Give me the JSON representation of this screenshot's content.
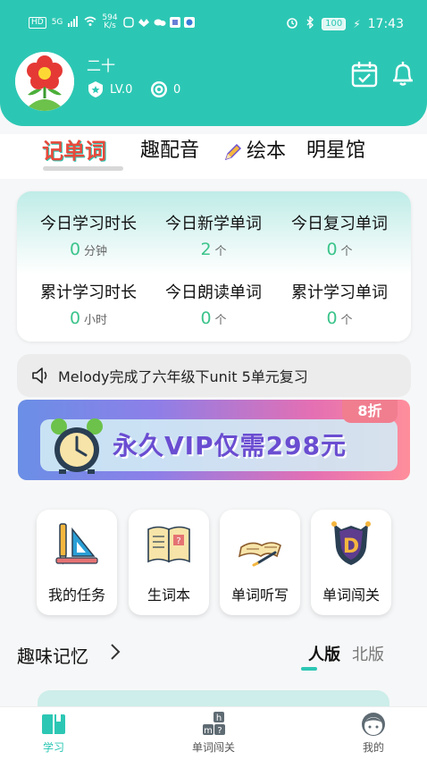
{
  "status_bar": {
    "left": {
      "hd": "HD",
      "signal": "5G",
      "speed_value": "594",
      "speed_unit": "K/s"
    },
    "right": {
      "battery": "100",
      "time": "17:43"
    }
  },
  "profile": {
    "username": "二十",
    "level": "LV.0",
    "coins": "0"
  },
  "tabs": [
    {
      "label": "记单词",
      "active": true
    },
    {
      "label": "趣配音",
      "active": false
    },
    {
      "label": "绘本",
      "active": false,
      "icon": "pencil-icon"
    },
    {
      "label": "明星馆",
      "active": false
    }
  ],
  "stats": [
    {
      "label": "今日学习时长",
      "value": "0",
      "unit": "分钟"
    },
    {
      "label": "今日新学单词",
      "value": "2",
      "unit": "个"
    },
    {
      "label": "今日复习单词",
      "value": "0",
      "unit": "个"
    },
    {
      "label": "累计学习时长",
      "value": "0",
      "unit": "小时"
    },
    {
      "label": "今日朗读单词",
      "value": "0",
      "unit": "个"
    },
    {
      "label": "累计学习单词",
      "value": "0",
      "unit": "个"
    }
  ],
  "notice": {
    "text": "Melody完成了六年级下unit 5单元复习",
    "icon": "speaker-icon"
  },
  "banner": {
    "text": "永久VIP仅需298元",
    "badge": "8折"
  },
  "shortcuts": [
    {
      "label": "我的任务",
      "icon": "ruler-pencil-icon"
    },
    {
      "label": "生词本",
      "icon": "book-icon"
    },
    {
      "label": "单词听写",
      "icon": "open-book-pen-icon"
    },
    {
      "label": "单词闯关",
      "icon": "shield-d-icon"
    }
  ],
  "fun_memory": {
    "title": "趣味记忆",
    "editions": [
      {
        "label": "人版",
        "active": true
      },
      {
        "label": "北版",
        "active": false
      }
    ]
  },
  "bottom_nav": [
    {
      "label": "学习",
      "active": true
    },
    {
      "label": "单词闯关",
      "active": false
    },
    {
      "label": "我的",
      "active": false
    }
  ],
  "colors": {
    "teal": "#2cc7b4",
    "green": "#3cc48b",
    "red": "#e74a3c"
  }
}
